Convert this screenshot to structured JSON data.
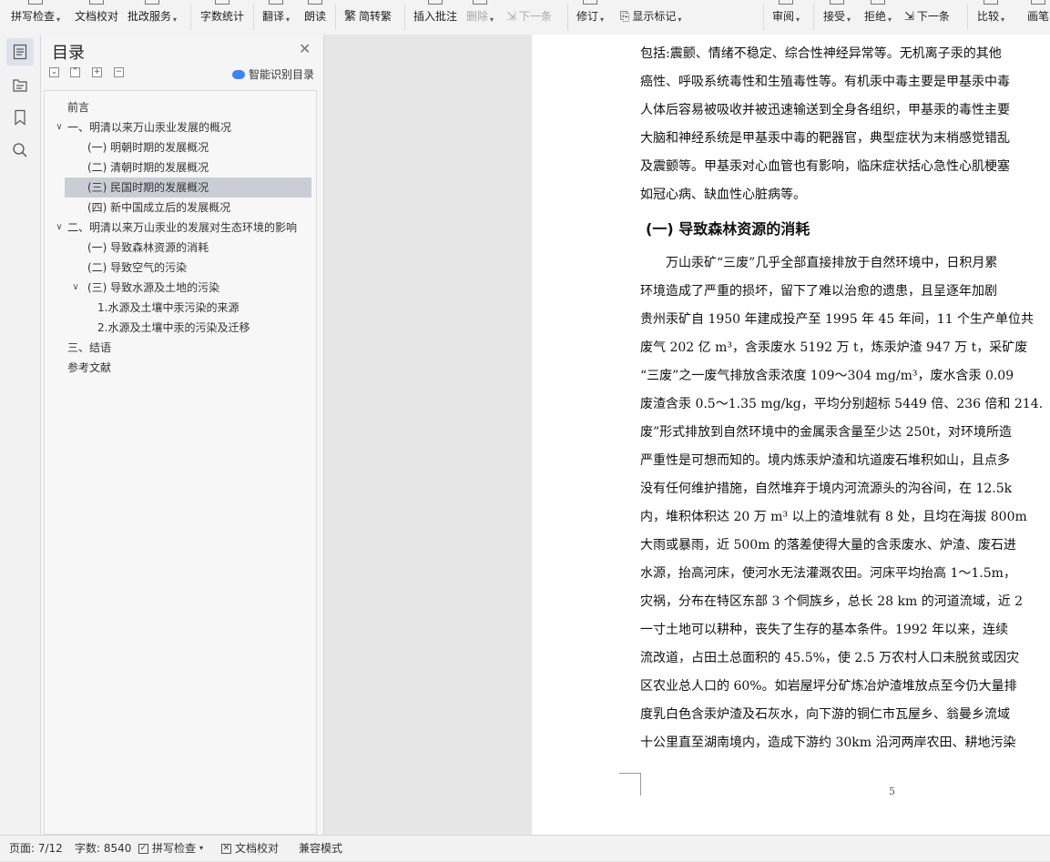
{
  "toolbar": {
    "items": [
      {
        "label": "拼写检查",
        "caret": true
      },
      {
        "label": "文档校对",
        "caret": false
      },
      {
        "label": "批改服务",
        "caret": true
      },
      {
        "label": "字数统计",
        "caret": false
      },
      {
        "label": "翻译",
        "caret": true
      },
      {
        "label": "朗读",
        "caret": false
      },
      {
        "label": "简转繁",
        "caret": false
      },
      {
        "label": "插入批注",
        "caret": false
      },
      {
        "label": "删除",
        "caret": true
      },
      {
        "label": "下一条",
        "caret": false
      },
      {
        "label": "修订",
        "caret": true
      },
      {
        "label": "显示标记",
        "caret": true
      },
      {
        "label": "审阅",
        "caret": true
      },
      {
        "label": "接受",
        "caret": true
      },
      {
        "label": "拒绝",
        "caret": true
      },
      {
        "label": "下一条",
        "caret": false
      },
      {
        "label": "比较",
        "caret": true
      },
      {
        "label": "画笔",
        "caret": false
      }
    ]
  },
  "toc": {
    "title": "目录",
    "smart_label": "智能识别目录",
    "entries": [
      {
        "text": "前言"
      },
      {
        "text": "一、明清以来万山汞业发展的概况"
      },
      {
        "text": "(一) 明朝时期的发展概况"
      },
      {
        "text": "(二) 清朝时期的发展概况"
      },
      {
        "text": "(三) 民国时期的发展概况"
      },
      {
        "text": "(四) 新中国成立后的发展概况"
      },
      {
        "text": "二、明清以来万山汞业的发展对生态环境的影响"
      },
      {
        "text": "(一) 导致森林资源的消耗"
      },
      {
        "text": "(二) 导致空气的污染"
      },
      {
        "text": "(三) 导致水源及土地的污染"
      },
      {
        "text": "1.水源及土壤中汞污染的来源"
      },
      {
        "text": "2.水源及土壤中汞的污染及迁移"
      },
      {
        "text": "三、结语"
      },
      {
        "text": "参考文献"
      }
    ]
  },
  "document": {
    "lines_top": [
      "包括:震颤、情绪不稳定、综合性神经异常等。无机离子汞的其他",
      "癌性、呼吸系统毒性和生殖毒性等。有机汞中毒主要是甲基汞中毒",
      "人体后容易被吸收并被迅速输送到全身各组织，甲基汞的毒性主要",
      "大脑和神经系统是甲基汞中毒的靶器官，典型症状为末梢感觉错乱",
      "及震颤等。甲基汞对心血管也有影响，临床症状括心急性心肌梗塞",
      "如冠心病、缺血性心脏病等。"
    ],
    "heading": "(一) 导致森林资源的消耗",
    "lines_body": [
      "　　万山汞矿“三废”几乎全部直接排放于自然环境中，日积月累",
      "环境造成了严重的损坏，留下了难以治愈的遗患，且呈逐年加剧",
      "贵州汞矿自 1950 年建成投产至 1995 年 45 年间，11 个生产单位共",
      "废气 202 亿 m³，含汞废水 5192 万 t，炼汞炉渣 947 万 t，采矿废",
      "“三废”之一废气排放含汞浓度 109～304 mg/m³，废水含汞 0.09",
      "废渣含汞 0.5～1.35 mg/kg，平均分别超标 5449 倍、236 倍和 214.",
      "废”形式排放到自然环境中的金属汞含量至少达 250t，对环境所造",
      "严重性是可想而知的。境内炼汞炉渣和坑道废石堆积如山，且点多",
      "没有任何维护措施，自然堆弃于境内河流源头的沟谷间，在 12.5k",
      "内，堆积体积达 20 万 m³ 以上的渣堆就有 8 处，且均在海拔 800m",
      "大雨或暴雨，近 500m 的落差使得大量的含汞废水、炉渣、废石进",
      "水源，抬高河床，使河水无法灌溉农田。河床平均抬高 1～1.5m，",
      "灾祸，分布在特区东部 3 个侗族乡，总长 28 km 的河道流域，近 2",
      "一寸土地可以耕种，丧失了生存的基本条件。1992 年以来，连续",
      "流改道，占田土总面积的 45.5%，使 2.5 万农村人口未脱贫或因灾",
      "区农业总人口的 60%。如岩屋坪分矿炼冶炉渣堆放点至今仍大量排",
      "度乳白色含汞炉渣及石灰水，向下游的铜仁市瓦屋乡、翁曼乡流域",
      "十公里直至湖南境内，造成下游约 30km 沿河两岸农田、耕地污染"
    ],
    "page_number": "5"
  },
  "status": {
    "page": "页面: 7/12",
    "words": "字数: 8540",
    "spell": "拼写检查",
    "proof": "文档校对",
    "compat": "兼容模式"
  },
  "colors": {
    "selected_bg": "#c9ced6",
    "smart_icon": "#3b86f0"
  }
}
